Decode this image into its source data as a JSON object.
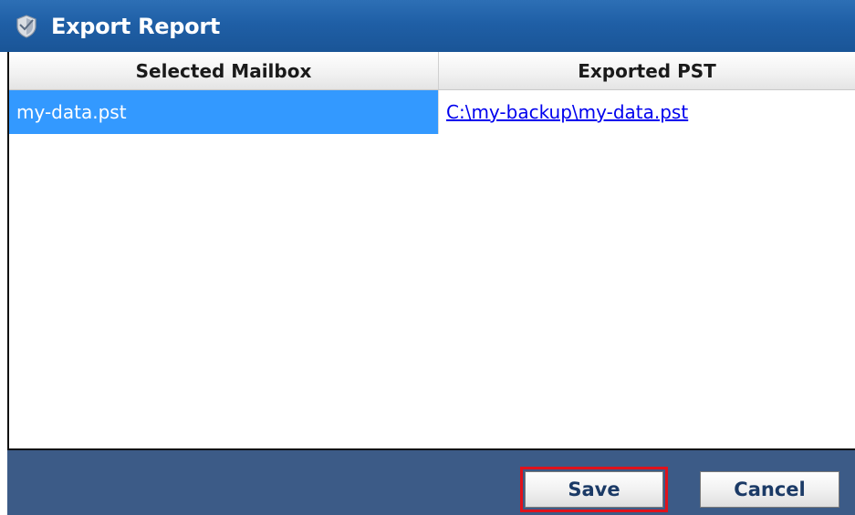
{
  "window": {
    "title": "Export Report",
    "icon": "app-shield-icon"
  },
  "table": {
    "columns": [
      "Selected Mailbox",
      "Exported PST"
    ],
    "rows": [
      {
        "mailbox": "my-data.pst",
        "exported_pst": "C:\\my-backup\\my-data.pst",
        "selected": true
      }
    ]
  },
  "footer": {
    "save_label": "Save",
    "cancel_label": "Cancel",
    "highlighted_button": "Save"
  },
  "colors": {
    "titlebar": "#1f5fa6",
    "selection": "#3399ff",
    "footer": "#3c5b87",
    "highlight_outline": "#e0121b",
    "link": "#0000ee"
  }
}
